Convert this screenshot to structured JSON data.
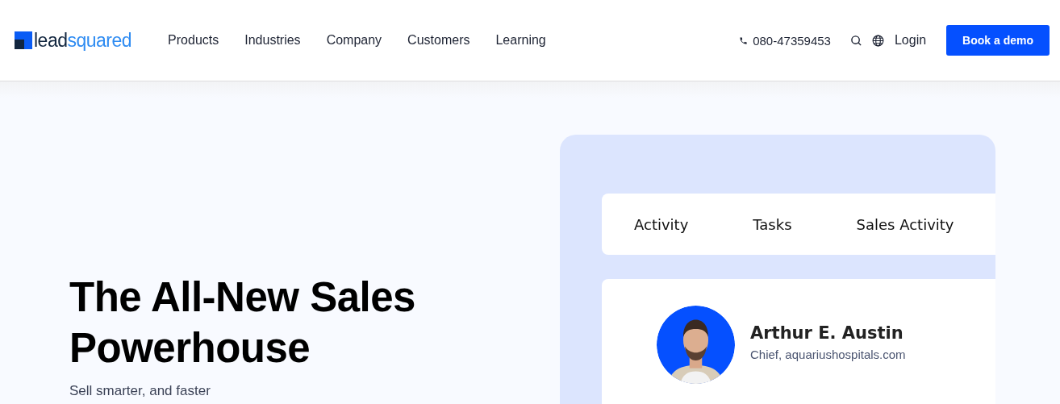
{
  "header": {
    "logo": {
      "part_1": "lead",
      "part_2": "squared"
    },
    "nav": [
      "Products",
      "Industries",
      "Company",
      "Customers",
      "Learning"
    ],
    "phone": "080-47359453",
    "login": "Login",
    "cta": "Book a demo"
  },
  "hero": {
    "title": "The All-New Sales Powerhouse",
    "subtitle": "Sell smarter, and faster"
  },
  "panel": {
    "tabs": [
      "Activity",
      "Tasks",
      "Sales Activity"
    ],
    "contact": {
      "name": "Arthur E. Austin",
      "role": "Chief, aquariushospitals.com"
    }
  }
}
